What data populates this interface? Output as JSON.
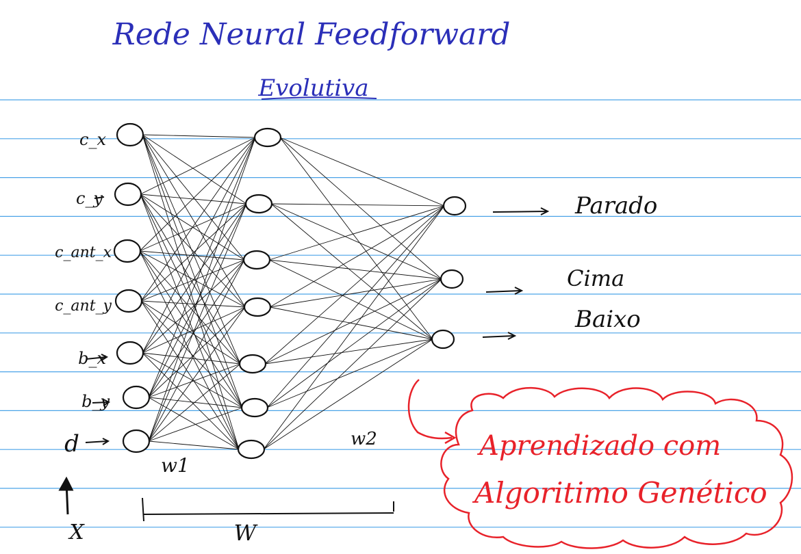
{
  "title": {
    "line1": "Rede Neural Feedforward",
    "line2": "Evolutiva"
  },
  "inputs": [
    "c_x",
    "c_y",
    "c_ant_x",
    "c_ant_y",
    "b_x",
    "b_y",
    "d"
  ],
  "outputs": [
    "Parado",
    "Cima",
    "Baixo"
  ],
  "weights": {
    "w1": "w1",
    "w2": "w2",
    "W": "W"
  },
  "input_vector_label": "X",
  "callout": {
    "line1": "Aprendizado com",
    "line2": "Algoritimo Genético"
  },
  "colors": {
    "ruled_lines": "#4aa3e8",
    "ink": "#111111",
    "title_ink": "#2b2fb8",
    "callout_ink": "#e8222a"
  }
}
